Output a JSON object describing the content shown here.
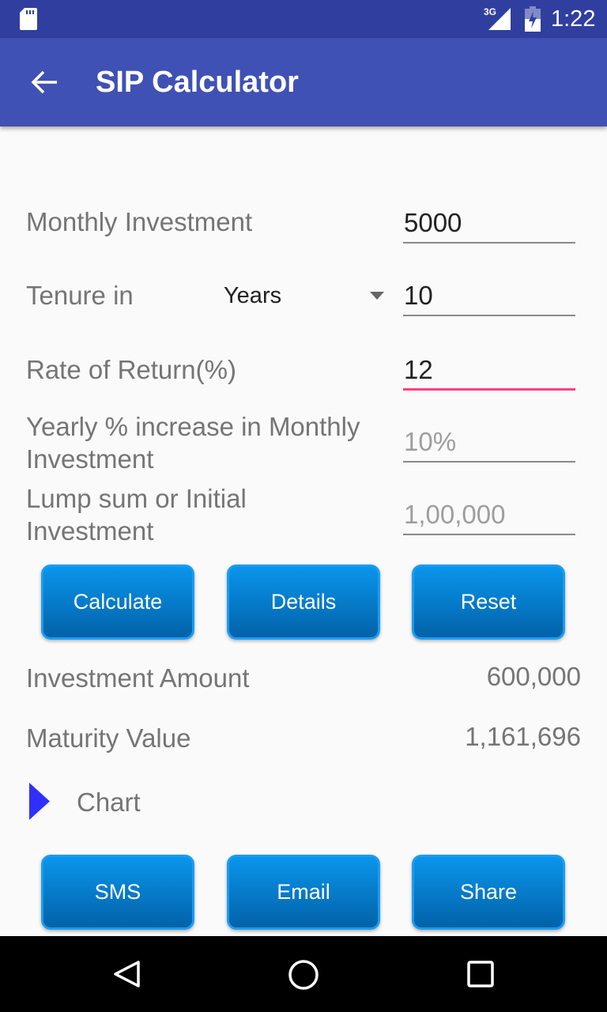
{
  "status_bar": {
    "time": "1:22",
    "network": "3G"
  },
  "app_bar": {
    "title": "SIP Calculator"
  },
  "form": {
    "monthly_investment": {
      "label": "Monthly Investment",
      "value": "5000"
    },
    "tenure": {
      "label": "Tenure in",
      "unit": "Years",
      "value": "10"
    },
    "rate": {
      "label": "Rate of Return(%)",
      "value": "12"
    },
    "yearly_increase": {
      "label_line1": "Yearly % increase in Monthly",
      "label_line2": "Investment",
      "placeholder": "10%"
    },
    "lump_sum": {
      "label_line1": "Lump sum or Initial",
      "label_line2": "Investment",
      "placeholder": "1,00,000"
    }
  },
  "buttons": {
    "calculate": "Calculate",
    "details": "Details",
    "reset": "Reset",
    "sms": "SMS",
    "email": "Email",
    "share": "Share"
  },
  "results": {
    "investment_label": "Investment Amount",
    "investment_value": "600,000",
    "maturity_label": "Maturity Value",
    "maturity_value": "1,161,696"
  },
  "chart_toggle": {
    "label": "Chart"
  },
  "colors": {
    "primary": "#3f51b5",
    "primary_dark": "#303f9f",
    "accent": "#ff4081",
    "button": "#0a80d0"
  }
}
